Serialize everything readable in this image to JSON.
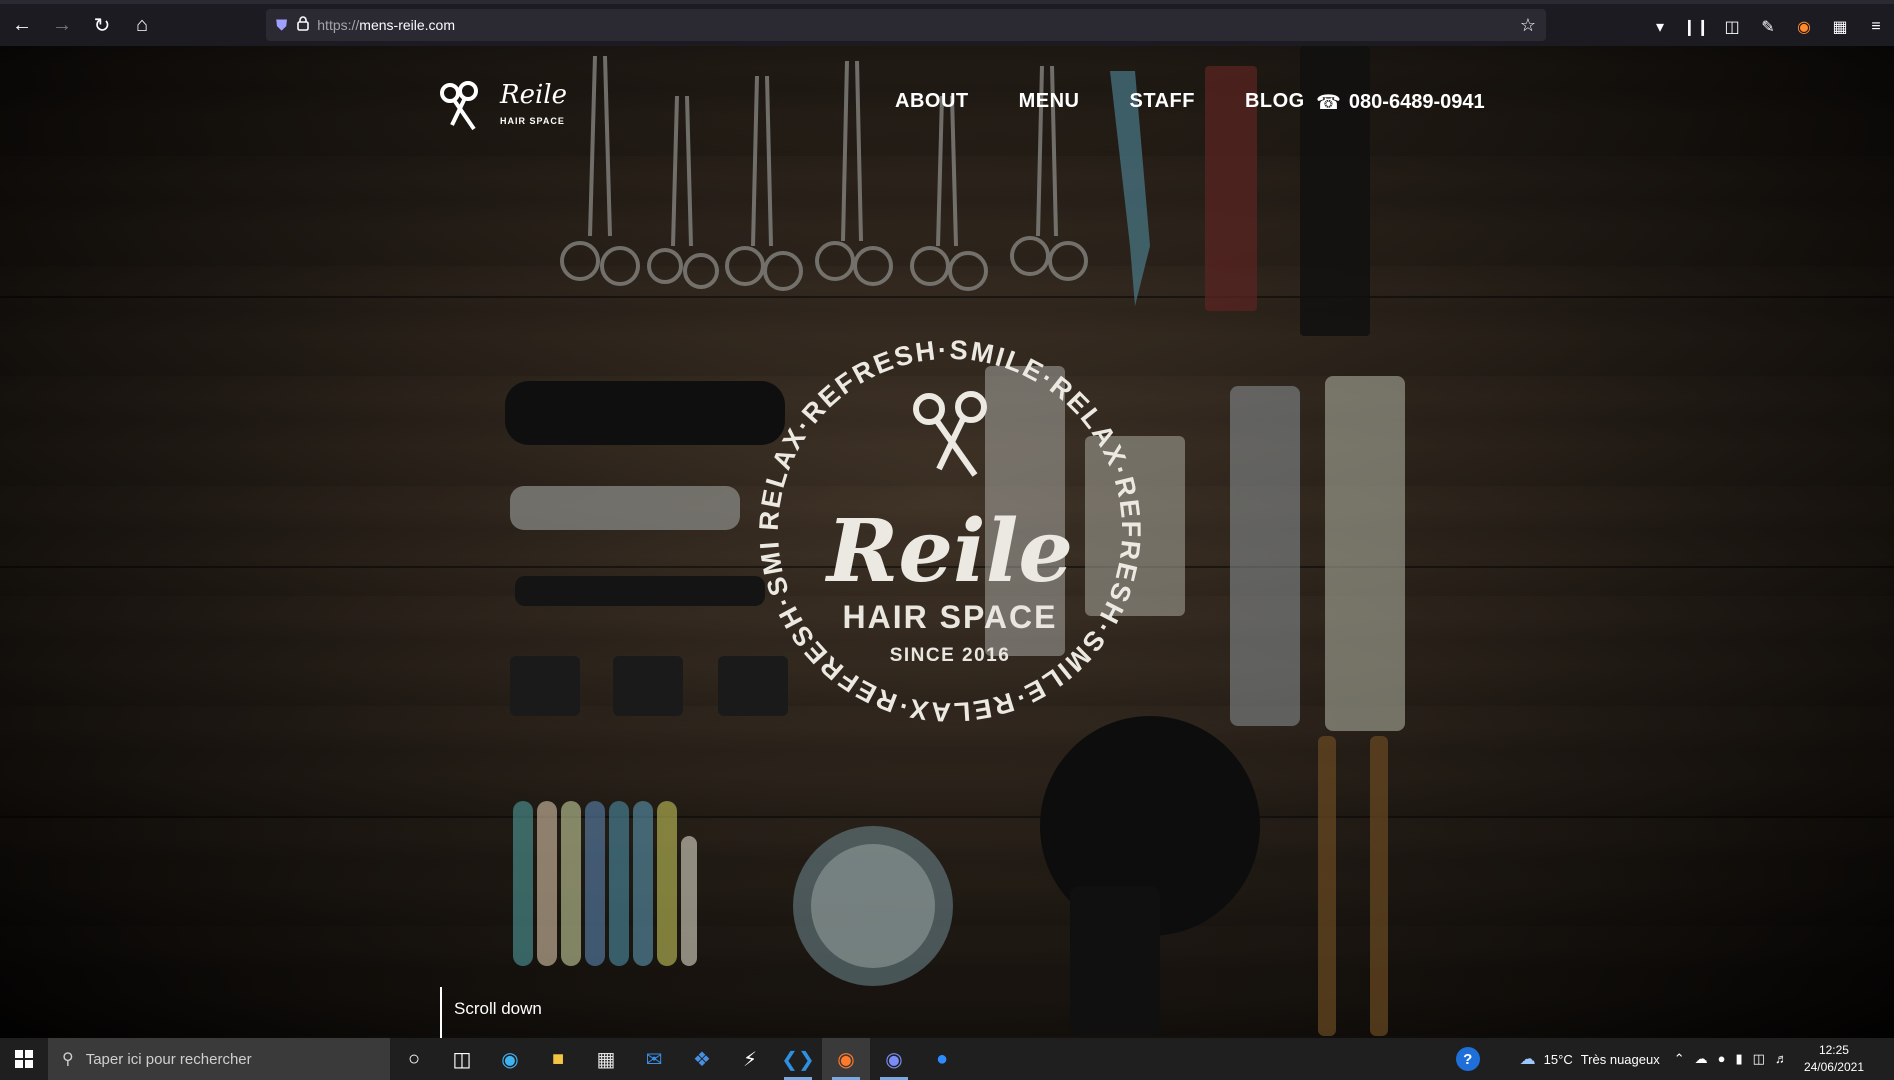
{
  "browser": {
    "url_scheme": "https://",
    "url_host": "mens-reile.com"
  },
  "site": {
    "logo": {
      "name": "Reile",
      "sub": "HAIR SPACE"
    },
    "nav": [
      "ABOUT",
      "MENU",
      "STAFF",
      "BLOG"
    ],
    "phone": "080-6489-0941",
    "emblem": {
      "ring_text": "RELAX·REFRESH·SMILE·RELAX·REFRESH·SMILE·RELAX·REFRESH·SMILE·",
      "brand": "Reile",
      "sub": "HAIR SPACE",
      "since": "SINCE 2016"
    },
    "scroll_label": "Scroll down"
  },
  "taskbar": {
    "search_placeholder": "Taper ici pour rechercher",
    "weather_temp": "15°C",
    "weather_desc": "Très nuageux",
    "time": "12:25",
    "date": "24/06/2021"
  },
  "colors": {
    "browser_bg": "#1c1b22",
    "urlbar_bg": "#2b2a33",
    "taskbar_bg": "#1f1f1f",
    "accent_blue": "#1e6fd9"
  },
  "icons": {
    "browser": [
      "back-icon",
      "forward-icon",
      "reload-icon",
      "home-icon",
      "shield-icon",
      "lock-icon",
      "bookmark-star-icon",
      "pocket-icon",
      "library-icon",
      "sidebar-icon",
      "pen-icon",
      "metamask-icon",
      "extensions-icon",
      "menu-icon"
    ],
    "taskbar": [
      "windows-start-icon",
      "search-icon",
      "cortana-icon",
      "task-view-icon",
      "edge-icon",
      "file-explorer-icon",
      "store-icon",
      "mail-icon",
      "dropbox-icon",
      "app-icon",
      "vscode-icon",
      "firefox-icon",
      "discord-icon",
      "zoom-icon",
      "help-icon",
      "cloud-weather-icon"
    ]
  }
}
